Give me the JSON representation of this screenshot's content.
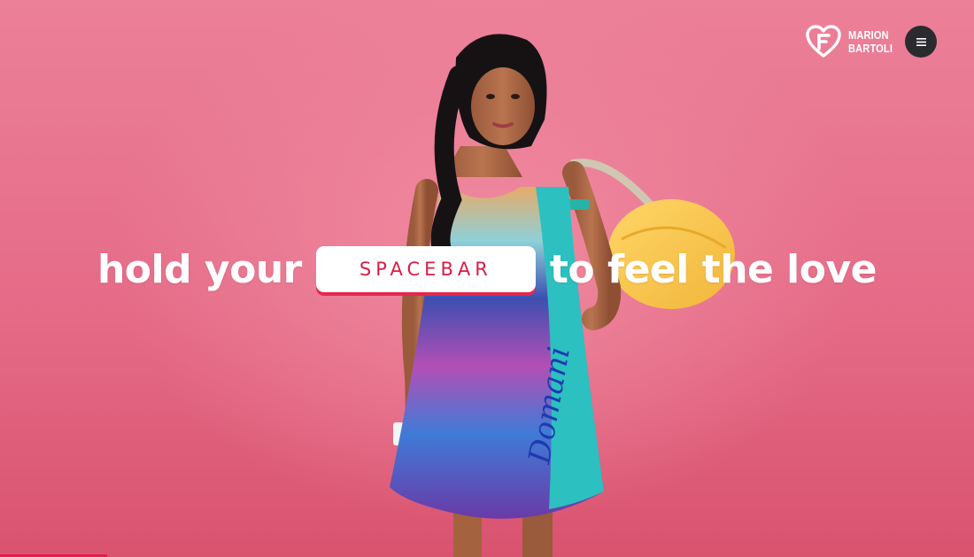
{
  "brand": {
    "name_line1": "MARION",
    "name_line2": "BARTOLI",
    "logo_icon": "heart-f-logo-icon"
  },
  "menu": {
    "icon": "hamburger-menu-icon"
  },
  "headline": {
    "before": "hold your",
    "key_label": "SPACEBAR",
    "after": "to feel the love"
  },
  "dress_print_text": "Domani",
  "progress": {
    "value": 0.11
  },
  "colors": {
    "background": "#e97590",
    "accent": "#e31b4d",
    "menu_button": "#2b2b2f",
    "text": "#ffffff"
  }
}
